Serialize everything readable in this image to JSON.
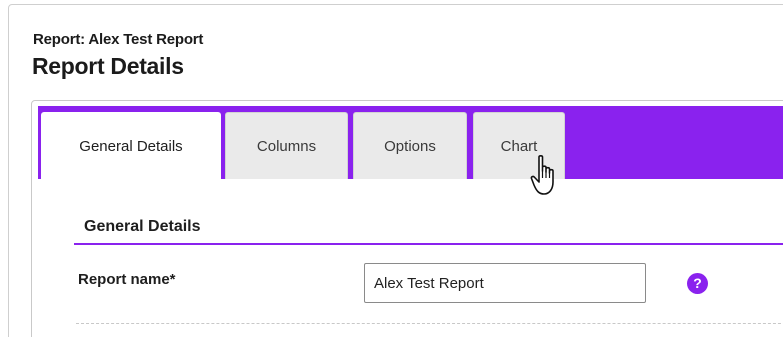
{
  "header": {
    "breadcrumb": "Report: Alex Test Report",
    "title": "Report Details"
  },
  "tabs": [
    {
      "label": "General Details",
      "active": true
    },
    {
      "label": "Columns",
      "active": false
    },
    {
      "label": "Options",
      "active": false
    },
    {
      "label": "Chart",
      "active": false,
      "hovered": true
    }
  ],
  "section": {
    "title": "General Details"
  },
  "form": {
    "report_name_label": "Report name*",
    "report_name_value": "Alex Test Report"
  },
  "icons": {
    "help": "question-mark-circle",
    "cursor": "hand-pointer"
  },
  "colors": {
    "accent": "#8a22ee",
    "tab_inactive": "#eaeaea"
  }
}
